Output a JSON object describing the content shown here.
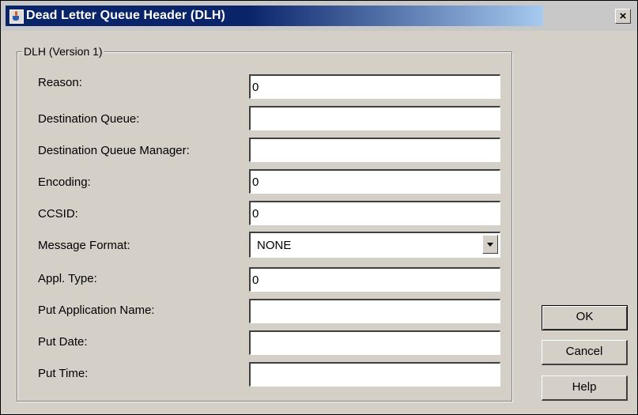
{
  "window": {
    "title": "Dead Letter Queue Header (DLH)"
  },
  "icons": {
    "title_icon": "java-cup-icon",
    "close_icon": "close-icon",
    "dropdown_icon": "chevron-down-icon"
  },
  "close_glyph": "×",
  "group": {
    "title": "DLH (Version 1)"
  },
  "fields": {
    "reason": {
      "label": "Reason:",
      "value": "0"
    },
    "destination_queue": {
      "label": "Destination Queue:",
      "value": ""
    },
    "destination_queue_manager": {
      "label": "Destination Queue Manager:",
      "value": ""
    },
    "encoding": {
      "label": "Encoding:",
      "value": "0"
    },
    "ccsid": {
      "label": "CCSID:",
      "value": "0"
    },
    "message_format": {
      "label": "Message Format:",
      "value": "NONE"
    },
    "appl_type": {
      "label": "Appl. Type:",
      "value": "0"
    },
    "put_application_name": {
      "label": "Put Application Name:",
      "value": ""
    },
    "put_date": {
      "label": "Put Date:",
      "value": ""
    },
    "put_time": {
      "label": "Put Time:",
      "value": ""
    }
  },
  "buttons": {
    "ok": "OK",
    "cancel": "Cancel",
    "help": "Help"
  },
  "colors": {
    "title_active": "#0a246a",
    "title_fade": "#a6caf0",
    "face": "#d4d0c8"
  }
}
